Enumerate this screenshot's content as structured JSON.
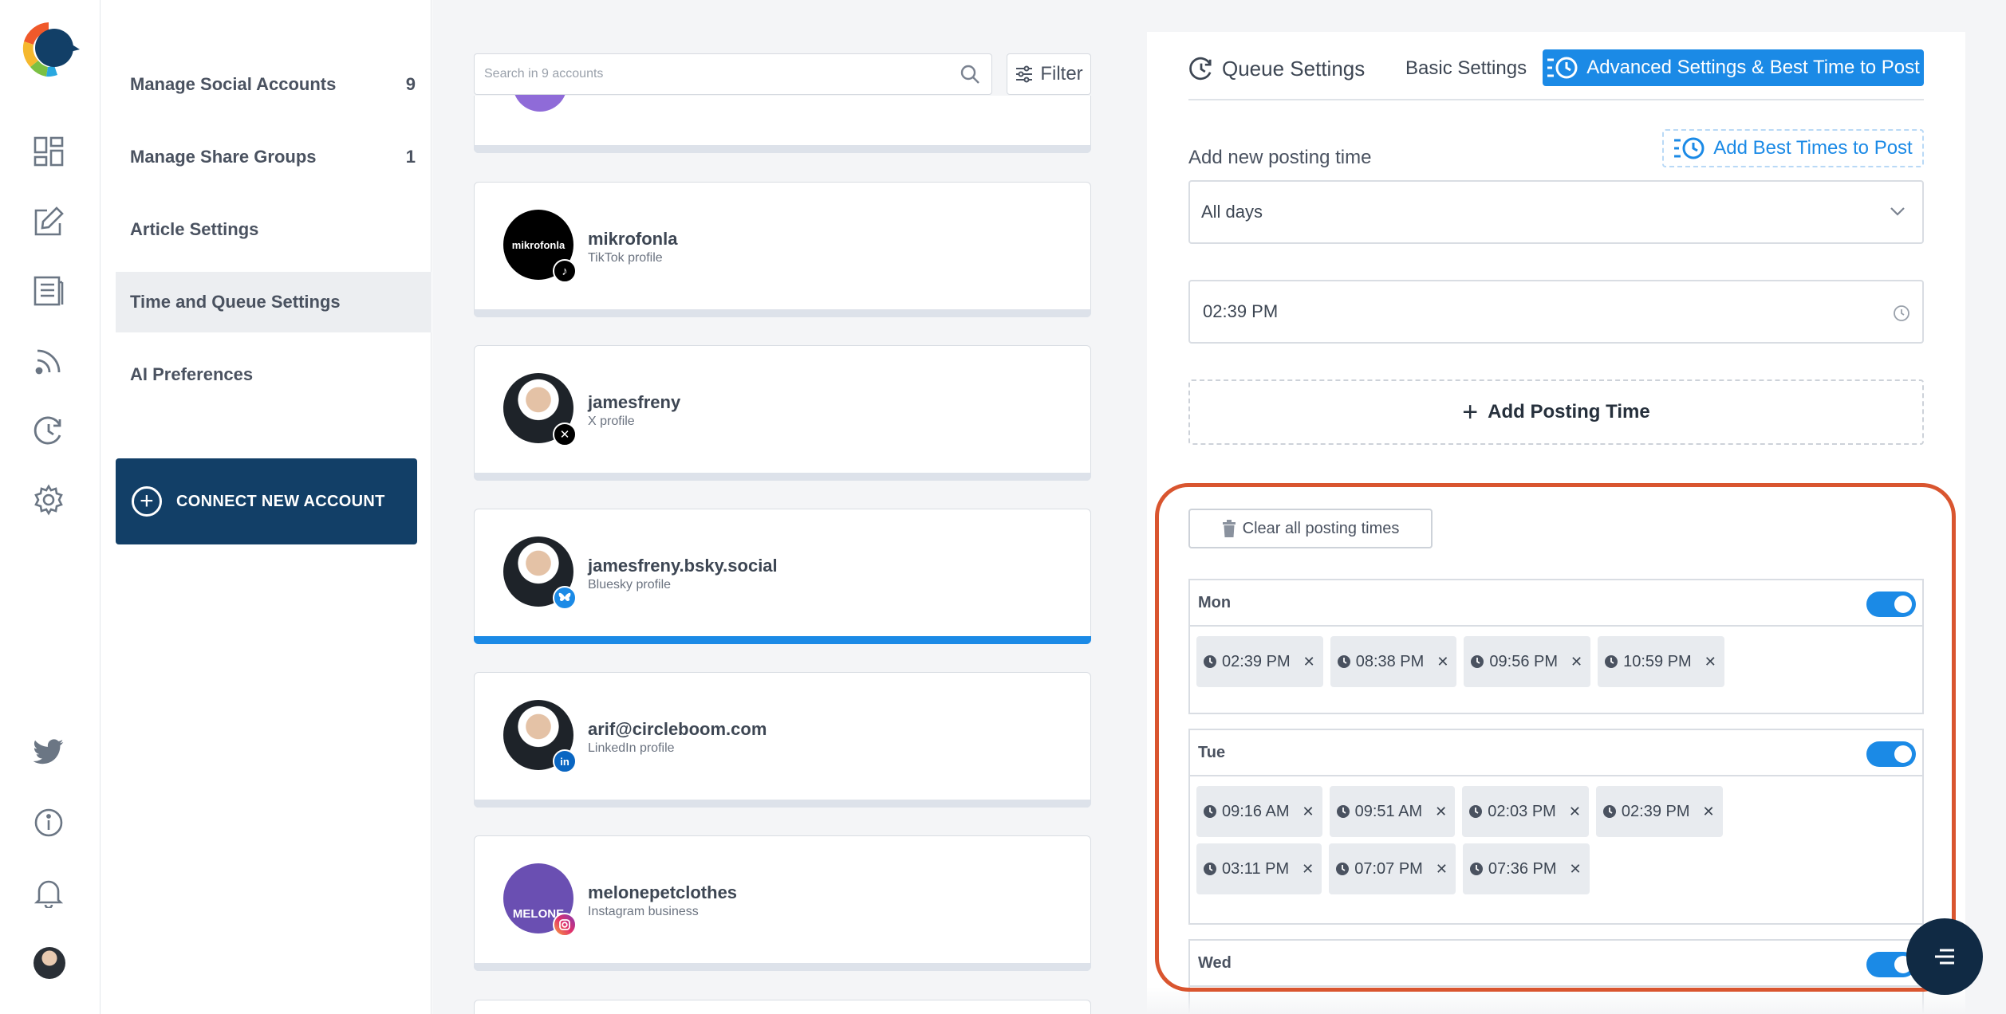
{
  "sidebar": {
    "items": [
      {
        "label": "Manage Social Accounts",
        "count": "9"
      },
      {
        "label": "Manage Share Groups",
        "count": "1"
      },
      {
        "label": "Article Settings",
        "count": ""
      },
      {
        "label": "Time and Queue Settings",
        "count": ""
      },
      {
        "label": "AI Preferences",
        "count": ""
      }
    ],
    "connect_label": "CONNECT NEW ACCOUNT"
  },
  "accounts": {
    "search_placeholder": "Search in 9 accounts",
    "filter_label": "Filter",
    "list": [
      {
        "name": "mikrofonla",
        "type": "TikTok profile",
        "avatar_text": "mikrofonla"
      },
      {
        "name": "jamesfreny",
        "type": "X profile"
      },
      {
        "name": "jamesfreny.bsky.social",
        "type": "Bluesky profile"
      },
      {
        "name": "arif@circleboom.com",
        "type": "LinkedIn profile",
        "badge": "in"
      },
      {
        "name": "melonepetclothes",
        "type": "Instagram business",
        "avatar_text": "MELONE"
      }
    ]
  },
  "settings": {
    "tabs": {
      "queue": "Queue Settings",
      "basic": "Basic Settings",
      "advanced": "Advanced Settings & Best Time to Post"
    },
    "add_new_label": "Add new posting time",
    "best_times_label": "Add Best Times to Post",
    "days_select": "All days",
    "time_value": "02:39 PM",
    "add_posting_label": "Add Posting Time",
    "clear_label": "Clear all posting times",
    "days": [
      {
        "name": "Mon",
        "times": [
          "02:39 PM",
          "08:38 PM",
          "09:56 PM",
          "10:59 PM"
        ]
      },
      {
        "name": "Tue",
        "times": [
          "09:16 AM",
          "09:51 AM",
          "02:03 PM",
          "02:39 PM",
          "03:11 PM",
          "07:07 PM",
          "07:36 PM"
        ]
      },
      {
        "name": "Wed",
        "times": []
      }
    ]
  },
  "colors": {
    "accent": "#1b8ae6",
    "navy": "#123f67",
    "highlight": "#d9552f"
  }
}
